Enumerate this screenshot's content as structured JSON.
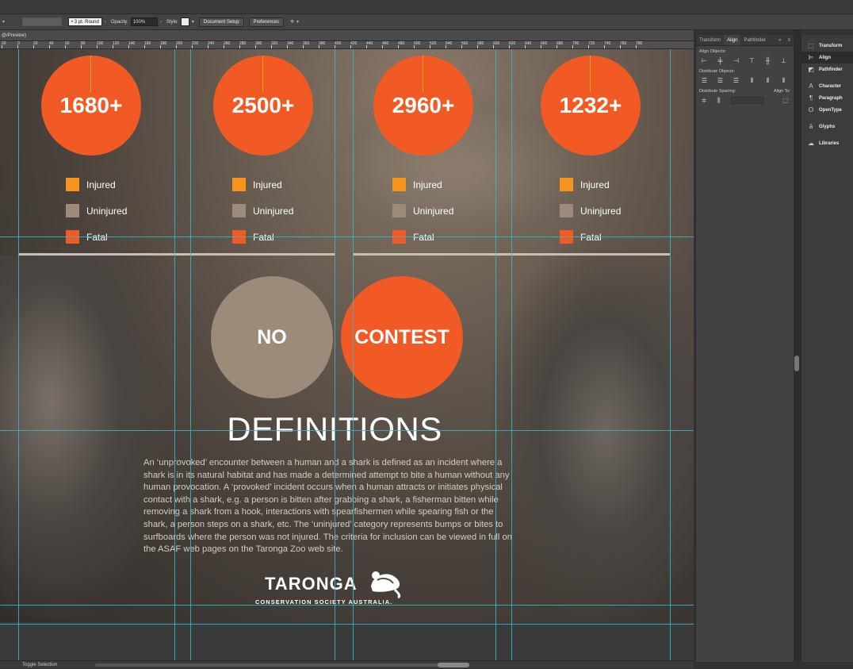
{
  "control_bar": {
    "stroke_profile": "3 pt. Round",
    "opacity_label": "Opacity:",
    "opacity_value": "100%",
    "style_label": "Style:",
    "document_setup": "Document Setup",
    "preferences": "Preferences"
  },
  "document_tab": {
    "label": "@/Preview)"
  },
  "ruler": {
    "ticks": [
      "20",
      "0",
      "20",
      "40",
      "60",
      "80",
      "100",
      "120",
      "140",
      "160",
      "180",
      "200",
      "220",
      "240",
      "260",
      "280",
      "300",
      "320",
      "340",
      "360",
      "380",
      "400",
      "420",
      "440",
      "460",
      "480",
      "500",
      "520",
      "540",
      "560",
      "580",
      "600",
      "620",
      "640",
      "660",
      "680",
      "700",
      "720",
      "740",
      "760",
      "780"
    ]
  },
  "infographic": {
    "stats": [
      {
        "value": "1680+"
      },
      {
        "value": "2500+"
      },
      {
        "value": "2960+"
      },
      {
        "value": "1232+"
      }
    ],
    "legend": [
      {
        "label": "Injured",
        "color": "#f7941d"
      },
      {
        "label": "Uninjured",
        "color": "#9c8a7a"
      },
      {
        "label": "Fatal",
        "color": "#f15a24"
      }
    ],
    "no_label": "NO",
    "contest_label": "CONTEST",
    "no_color": "#9c8a7a",
    "contest_color": "#f15a24",
    "definitions_title": "DEFINITIONS",
    "definitions_body": "An ‘unprovoked’ encounter between a human and a shark is defined as an incident where a shark is in its natural habitat and has made a determined attempt to bite a human without any human provocation. A ‘provoked’ incident occurs when a human attracts or initiates physical contact with a shark, e.g. a person is bitten after grabbing a shark, a fisherman bitten while removing a shark from a hook, interactions with spearfishermen while spearing fish or the shark, a person steps on a shark, etc. The ‘uninjured’ category represents bumps or bites to surfboards where the person was not injured. The criteria for inclusion can be viewed in full on the ASAF web pages on the Taronga Zoo web site.",
    "logo_word": "TARONGA",
    "logo_sub": "CONSERVATION SOCIETY AUSTRALIA."
  },
  "align_panel": {
    "tabs": [
      "Transform",
      "Align",
      "Pathfinder"
    ],
    "active_tab": "Align",
    "align_objects": "Align Objects:",
    "distribute_objects": "Distribute Objects:",
    "distribute_spacing": "Distribute Spacing:",
    "align_to": "Align To:"
  },
  "dock": {
    "items": [
      {
        "label": "Transform",
        "icon": "transform-icon"
      },
      {
        "label": "Align",
        "icon": "align-icon"
      },
      {
        "label": "Pathfinder",
        "icon": "pathfinder-icon"
      },
      {
        "label": "Character",
        "icon": "character-icon"
      },
      {
        "label": "Paragraph",
        "icon": "paragraph-icon"
      },
      {
        "label": "OpenType",
        "icon": "opentype-icon"
      },
      {
        "label": "Glyphs",
        "icon": "glyphs-icon"
      },
      {
        "label": "Libraries",
        "icon": "libraries-icon"
      }
    ]
  },
  "status_bar": {
    "label": "Toggle Selection"
  }
}
